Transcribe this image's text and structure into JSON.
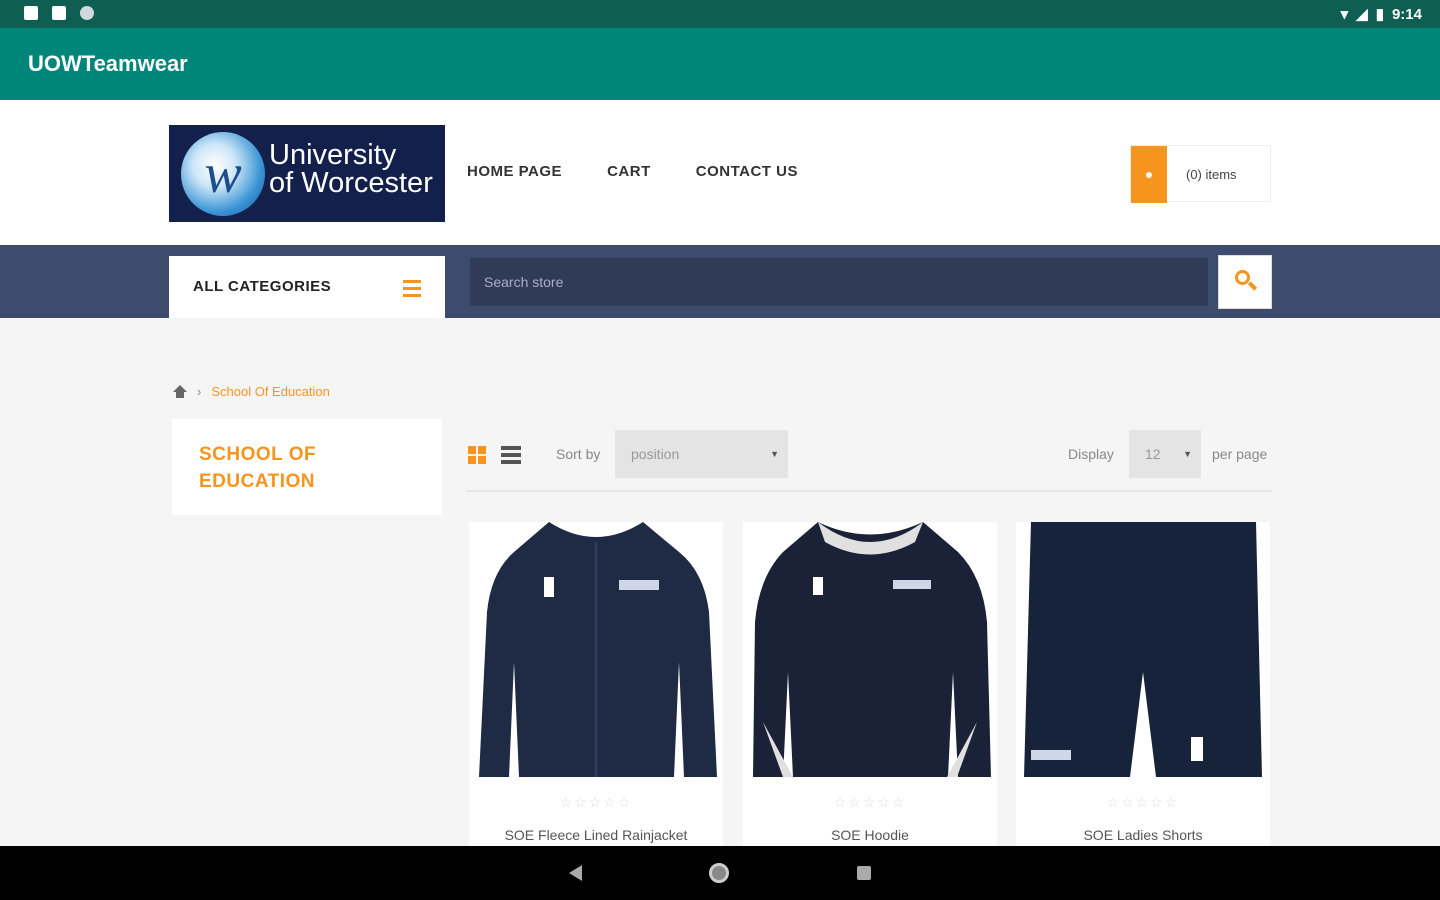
{
  "status_bar": {
    "time": "9:14"
  },
  "app": {
    "title": "UOWTeamwear"
  },
  "logo": {
    "line1": "University",
    "line2": "of Worcester"
  },
  "nav": {
    "items": [
      "HOME PAGE",
      "CART",
      "CONTACT US"
    ]
  },
  "cart": {
    "label": "(0) items"
  },
  "categories": {
    "label": "ALL CATEGORIES"
  },
  "search": {
    "placeholder": "Search store"
  },
  "breadcrumb": {
    "current": "School Of Education"
  },
  "sidebar": {
    "title": "SCHOOL OF EDUCATION"
  },
  "toolbar": {
    "sort_label": "Sort by",
    "sort_value": "position",
    "display_label": "Display",
    "display_value": "12",
    "per_page_label": "per page"
  },
  "products": [
    {
      "name": "SOE Fleece Lined Rainjacket",
      "rating": 0
    },
    {
      "name": "SOE Hoodie",
      "rating": 0
    },
    {
      "name": "SOE Ladies Shorts",
      "rating": 0
    }
  ],
  "colors": {
    "app_bar": "#00857a",
    "accent": "#f7941d",
    "band": "#3d4b6c"
  }
}
